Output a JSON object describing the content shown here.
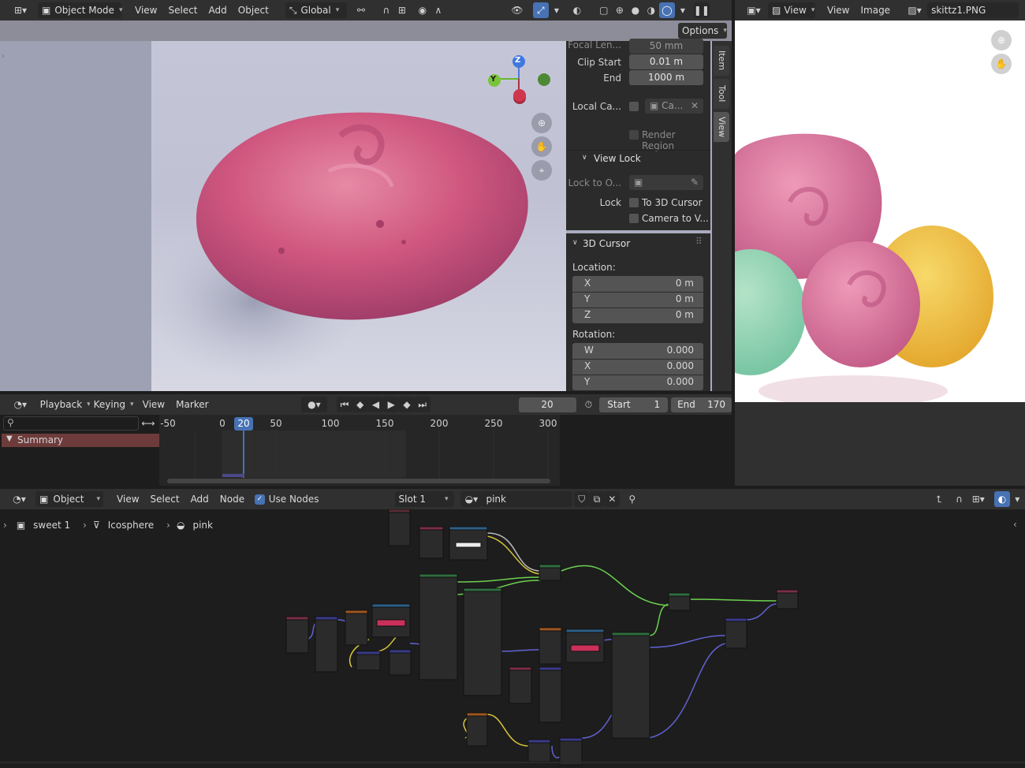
{
  "viewport_header": {
    "mode": "Object Mode",
    "menu": [
      "View",
      "Select",
      "Add",
      "Object"
    ],
    "orientation": "Global",
    "options_label": "Options"
  },
  "image_editor": {
    "menu": [
      "View",
      "View",
      "Image"
    ],
    "image_name": "skittz1.PNG"
  },
  "sidebar": {
    "tabs": [
      "Item",
      "Tool",
      "View"
    ],
    "focal_label": "Focal Len...",
    "focal_value": "50 mm",
    "clip_start_label": "Clip Start",
    "clip_start_value": "0.01 m",
    "clip_end_label": "End",
    "clip_end_value": "1000 m",
    "local_camera_label": "Local Ca...",
    "local_camera_value": "Ca...",
    "render_region_label": "Render Region",
    "view_lock_title": "View Lock",
    "lock_to_object_label": "Lock to O...",
    "lock_label": "Lock",
    "to_3d_cursor_label": "To 3D Cursor",
    "camera_to_view_label": "Camera to V...",
    "cursor_title": "3D Cursor",
    "location_label": "Location:",
    "location": [
      {
        "axis": "X",
        "value": "0 m"
      },
      {
        "axis": "Y",
        "value": "0 m"
      },
      {
        "axis": "Z",
        "value": "0 m"
      }
    ],
    "rotation_label": "Rotation:",
    "rotation": [
      {
        "axis": "W",
        "value": "0.000"
      },
      {
        "axis": "X",
        "value": "0.000"
      },
      {
        "axis": "Y",
        "value": "0.000"
      }
    ]
  },
  "timeline": {
    "menu": [
      "Playback",
      "Keying",
      "View",
      "Marker"
    ],
    "current_frame": "20",
    "start_label": "Start",
    "start_value": "1",
    "end_label": "End",
    "end_value": "170",
    "ruler_ticks": [
      "-50",
      "0",
      "50",
      "100",
      "150",
      "200",
      "250",
      "300"
    ],
    "playhead_label": "20",
    "summary_label": "Summary"
  },
  "node_editor": {
    "object_type": "Object",
    "menu": [
      "View",
      "Select",
      "Add",
      "Node"
    ],
    "use_nodes_label": "Use Nodes",
    "slot": "Slot 1",
    "material": "pink",
    "breadcrumb": [
      "sweet 1",
      "Icosphere",
      "pink"
    ]
  },
  "gizmo": {
    "z": "Z",
    "y": "Y"
  },
  "colors": {
    "accent": "#4772b3",
    "panel": "#303030",
    "viewport_bg": "#b3b6ca",
    "candy_pink": "#cc4f7c",
    "wire_green": "#6bd04f",
    "wire_blue": "#6262d4",
    "wire_yellow": "#d6c43c"
  }
}
